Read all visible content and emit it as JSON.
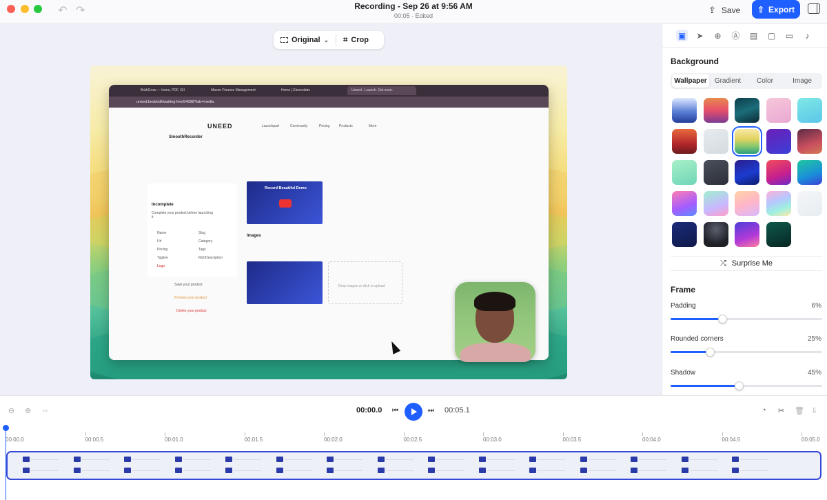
{
  "titlebar": {
    "title": "Recording - Sep 26 at 9:56 AM",
    "subtitle": "00:05 · Edited",
    "save_label": "Save",
    "export_label": "Export"
  },
  "view_toolbar": {
    "original_label": "Original",
    "crop_label": "Crop"
  },
  "recording_preview": {
    "url": "uneed.best/edit/waiting-line/54998?tab=media",
    "tabs": [
      "BrühGrow — Icons, PDF, GII",
      "Maven Finance Management",
      "Home | Elevenlabs",
      "Uneed - Launch. Get seen."
    ],
    "brand": "UNEED",
    "nav": [
      "Launchpad",
      "Community",
      "Pricing",
      "Products",
      "More"
    ],
    "product_name": "SmoothRecorder",
    "status_title": "Incomplete",
    "status_text": "Complete your product before launching it",
    "checklist": [
      "Name",
      "Slug",
      "Url",
      "Category",
      "Pricing",
      "Tags",
      "Tagline",
      "RichDescription",
      "Logo"
    ],
    "save_product": "Save your product",
    "preview_product": "Preview your product",
    "delete_product": "Delete your product",
    "images_title": "Images",
    "video_title": "Record Beautiful Demo",
    "drop_text": "Drop images or click to upload"
  },
  "right_panel": {
    "background_title": "Background",
    "bg_tabs": [
      "Wallpaper",
      "Gradient",
      "Color",
      "Image"
    ],
    "active_bg_tab": "Wallpaper",
    "surprise_label": "Surprise Me",
    "frame_title": "Frame",
    "sliders": [
      {
        "label": "Padding",
        "value": "6%",
        "level": 0.34
      },
      {
        "label": "Rounded corners",
        "value": "25%",
        "level": 0.26
      },
      {
        "label": "Shadow",
        "value": "45%",
        "level": 0.45
      }
    ],
    "swatch_gradients": [
      "linear-gradient(180deg,#dfe9ff,#5b7fd6 55%,#243e9a)",
      "linear-gradient(180deg,#e88a4e,#e64f6a 50%,#7c3a92)",
      "linear-gradient(160deg,#0c3d4a,#1c6d7a 50%,#0a2a33)",
      "linear-gradient(160deg,#f7c7d9,#e9a8d3)",
      "linear-gradient(160deg,#7ee8e6,#5cc6e8)",
      "linear-gradient(180deg,#e96a3c,#b2262b 60%,#6c1b1d)",
      "linear-gradient(160deg,#e7ebee,#d4dbe0)",
      "linear-gradient(180deg,#f6e9a8,#e3d35f 40%,#86c86f 70%,#2a9d7f)",
      "linear-gradient(160deg,#6a1fb8,#3b3fd8)",
      "linear-gradient(160deg,#5a2a44,#c74e5e 60%,#d47a57)",
      "linear-gradient(160deg,#a8f0c8,#6fd6b8)",
      "linear-gradient(160deg,#4a4f5c,#2c2f38)",
      "linear-gradient(160deg,#2b1d8c,#1c3bd0 55%,#0d1d6b)",
      "linear-gradient(160deg,#f24c5b,#c51f8e 60%,#6c2cc9)",
      "linear-gradient(160deg,#20c7a0,#1a8fd8 60%,#3c3fd8)",
      "linear-gradient(160deg,#ff7eb3,#a45cff 60%,#5b8cff)",
      "linear-gradient(160deg,#a0f0d0,#c7b8ff 60%,#ff9ec7)",
      "linear-gradient(160deg,#ffd3a5,#ffb6c7 50%,#d8b8ff)",
      "linear-gradient(160deg,#ffb0d8,#b6c7ff 40%,#9ef0e0 70%,#ffe9a8)",
      "linear-gradient(160deg,#f4f6f8,#e8edf1)",
      "linear-gradient(160deg,#1a2b7a,#0f1a4a)",
      "radial-gradient(circle at 50% 30%,#5a5f6c,#1e2026 70%)",
      "linear-gradient(160deg,#4e3fd8,#b23ad8 60%,#ff7e9e)",
      "linear-gradient(160deg,#0e5a48,#0a3a34 60%,#07261f)"
    ],
    "selected_swatch": 7
  },
  "timeline": {
    "current_time": "00:00.0",
    "total_time": "00:05.1",
    "ticks": [
      "00:00.0",
      "00:00.5",
      "00:01.0",
      "00:01.5",
      "00:02.0",
      "00:02.5",
      "00:03.0",
      "00:03.5",
      "00:04.0",
      "00:04.5",
      "00:05.0"
    ],
    "frame_count": 15
  }
}
